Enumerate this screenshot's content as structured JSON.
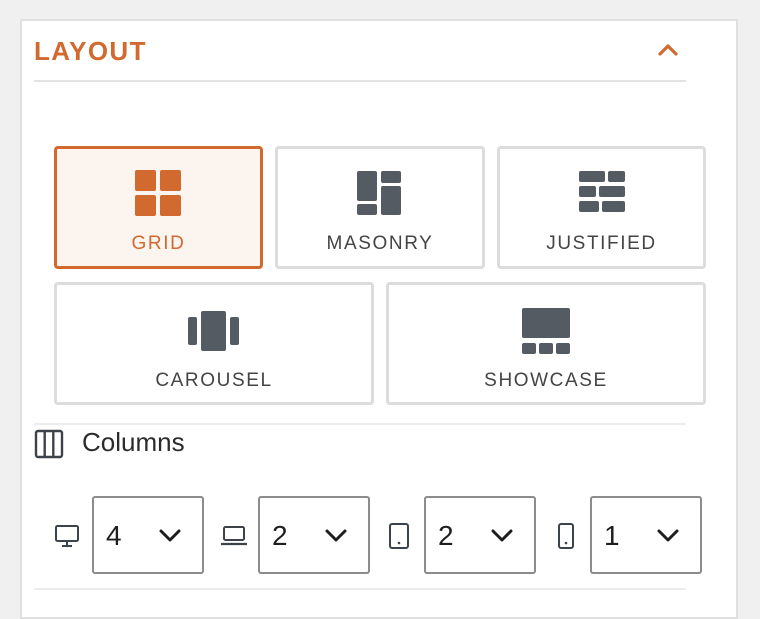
{
  "section": {
    "title": "LAYOUT",
    "accent_color": "#d2692f",
    "collapse_icon": "chevron-up-icon"
  },
  "layouts": [
    {
      "label": "GRID",
      "icon": "grid-icon",
      "active": true
    },
    {
      "label": "MASONRY",
      "icon": "masonry-icon",
      "active": false
    },
    {
      "label": "JUSTIFIED",
      "icon": "justified-icon",
      "active": false
    },
    {
      "label": "CAROUSEL",
      "icon": "carousel-icon",
      "active": false
    },
    {
      "label": "SHOWCASE",
      "icon": "showcase-icon",
      "active": false
    }
  ],
  "columns": {
    "label": "Columns",
    "icon": "columns-icon",
    "devices": [
      {
        "device": "desktop",
        "icon": "desktop-icon",
        "value": "4"
      },
      {
        "device": "laptop",
        "icon": "laptop-icon",
        "value": "2"
      },
      {
        "device": "tablet",
        "icon": "tablet-icon",
        "value": "2"
      },
      {
        "device": "mobile",
        "icon": "mobile-icon",
        "value": "1"
      }
    ]
  }
}
